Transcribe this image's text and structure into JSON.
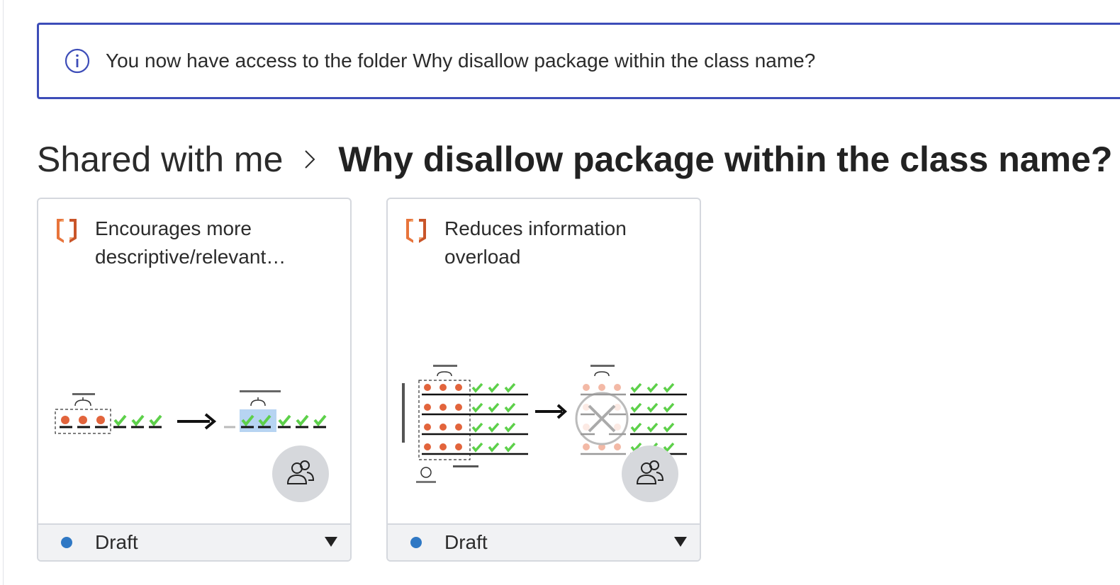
{
  "banner": {
    "icon": "info-icon",
    "message": "You now have access to the folder Why disallow package within the class name?"
  },
  "breadcrumb": {
    "root": "Shared with me",
    "separator_icon": "chevron-right-icon",
    "current": "Why disallow package within the class name?"
  },
  "cards": [
    {
      "logo_icon": "orange-cube-logo-icon",
      "title": "Encourages more descriptive/relevant…",
      "share_icon": "shared-users-icon",
      "status": {
        "label": "Draft",
        "dot_color": "#2f78c4",
        "caret_icon": "caret-down-icon"
      }
    },
    {
      "logo_icon": "orange-cube-logo-icon",
      "title": "Reduces information overload",
      "share_icon": "shared-users-icon",
      "status": {
        "label": "Draft",
        "dot_color": "#2f78c4",
        "caret_icon": "caret-down-icon"
      }
    }
  ],
  "colors": {
    "accent": "#3d4db8",
    "check": "#5dd04a",
    "gear": "#e2643c",
    "highlight": "#b7d4f2"
  }
}
